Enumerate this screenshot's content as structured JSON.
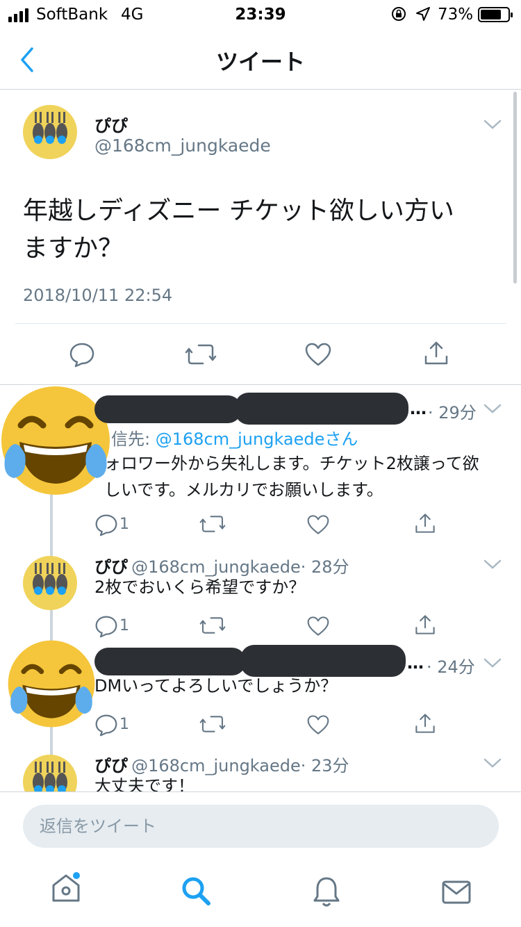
{
  "status_bar": {
    "carrier": "SoftBank",
    "network": "4G",
    "time": "23:39",
    "battery": "73%",
    "battery_level": 0.73
  },
  "nav": {
    "title": "ツイート",
    "back_icon": "chevron-left-icon"
  },
  "main_tweet": {
    "display_name": "ぴぴ",
    "handle": "@168cm_jungkaede",
    "text_line1": "年越しディズニー チケット欲しい方い",
    "text_line2": "ますか？",
    "timestamp": "2018/10/11 22:54"
  },
  "replies": [
    {
      "display_name": "",
      "handle": "",
      "time": "· 29分",
      "reply_to_prefix": "信先:",
      "reply_to_handle": "@168cm_jungkaedeさん",
      "text_line1": "ォロワー外から失礼します。チケット2枚譲って欲",
      "text_line2": "しいです。メルカリでお願いします。",
      "reply_count": "1"
    },
    {
      "display_name": "ぴぴ",
      "handle": "@168cm_jungkaede",
      "time": "· 28分",
      "text_line1": "2枚でおいくら希望ですか？",
      "reply_count": "1"
    },
    {
      "display_name": "",
      "handle": "",
      "time": "· 24分",
      "text_line1": "DMいってよろしいでしょうか？",
      "reply_count": "1"
    },
    {
      "display_name": "ぴぴ",
      "handle": "@168cm_jungkaede",
      "time": "· 23分",
      "text_line1": "大丈夫です！"
    }
  ],
  "reply_box": {
    "placeholder": "返信をツイート"
  },
  "colors": {
    "accent": "#1da1f2",
    "muted": "#657786",
    "divider": "#e1e8ed",
    "avatar_bg": "#f0d35a",
    "emoji": "#f5c63b"
  }
}
